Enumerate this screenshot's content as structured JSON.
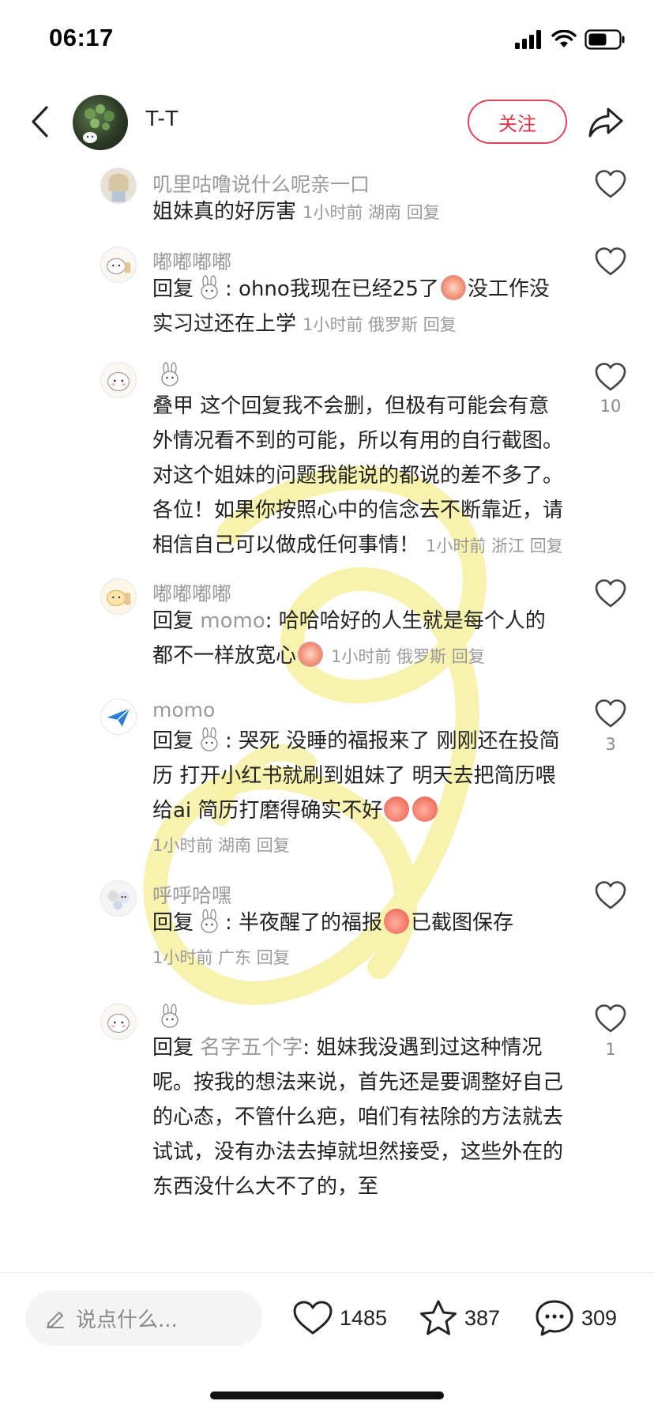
{
  "status_bar": {
    "time": "06:17"
  },
  "header": {
    "author": "T-T",
    "follow_label": "关注"
  },
  "comments": [
    {
      "name": "叽里咕噜说什么呢亲一口",
      "body": "姐妹真的好厉害",
      "meta": "1小时前 湖南 回复",
      "likes": ""
    },
    {
      "name": "嘟嘟嘟嘟",
      "reply_prefix": "回复",
      "body_a": ": ohno我现在已经25了",
      "body_b": "没工作没实习过还在上学",
      "meta": "1小时前 俄罗斯 回复",
      "likes": ""
    },
    {
      "name": "",
      "body": "叠甲 这个回复我不会删，但极有可能会有意外情况看不到的可能，所以有用的自行截图。对这个姐妹的问题我能说的都说的差不多了。各位！如果你按照心中的信念去不断靠近，请相信自己可以做成任何事情！",
      "meta": "1小时前 浙江 回复",
      "likes": "10"
    },
    {
      "name": "嘟嘟嘟嘟",
      "reply_prefix": "回复",
      "reply_to": "momo",
      "body": ": 哈哈哈好的人生就是每个人的都不一样放宽心",
      "meta": "1小时前 俄罗斯 回复",
      "likes": ""
    },
    {
      "name": "momo",
      "reply_prefix": "回复",
      "body": ": 哭死 没睡的福报来了 刚刚还在投简历 打开小红书就刷到姐妹了 明天去把简历喂给ai 简历打磨得确实不好",
      "meta": "1小时前 湖南 回复",
      "likes": "3"
    },
    {
      "name": "呼呼哈嘿",
      "reply_prefix": "回复",
      "body_a": ": 半夜醒了的福报",
      "body_b": "已截图保存",
      "meta": "1小时前 广东 回复",
      "likes": ""
    },
    {
      "name": "",
      "reply_prefix": "回复",
      "reply_to": "名字五个字",
      "body": ": 姐妹我没遇到过这种情况呢。按我的想法来说，首先还是要调整好自己的心态，不管什么疤，咱们有祛除的方法就去试试，没有办法去掉就坦然接受，这些外在的东西没什么大不了的，至",
      "meta": "",
      "likes": "1"
    }
  ],
  "bottom_bar": {
    "input_placeholder": "说点什么...",
    "like_count": "1485",
    "collect_count": "387",
    "comment_count": "309"
  },
  "colors": {
    "accent": "#e0334a",
    "muted": "#9a9a9a",
    "watermark": "#f6f0a0"
  },
  "icons": [
    "back-icon",
    "share-icon",
    "heart-icon",
    "star-icon",
    "chat-icon",
    "pencil-icon",
    "signal-icon",
    "wifi-icon",
    "battery-icon"
  ]
}
